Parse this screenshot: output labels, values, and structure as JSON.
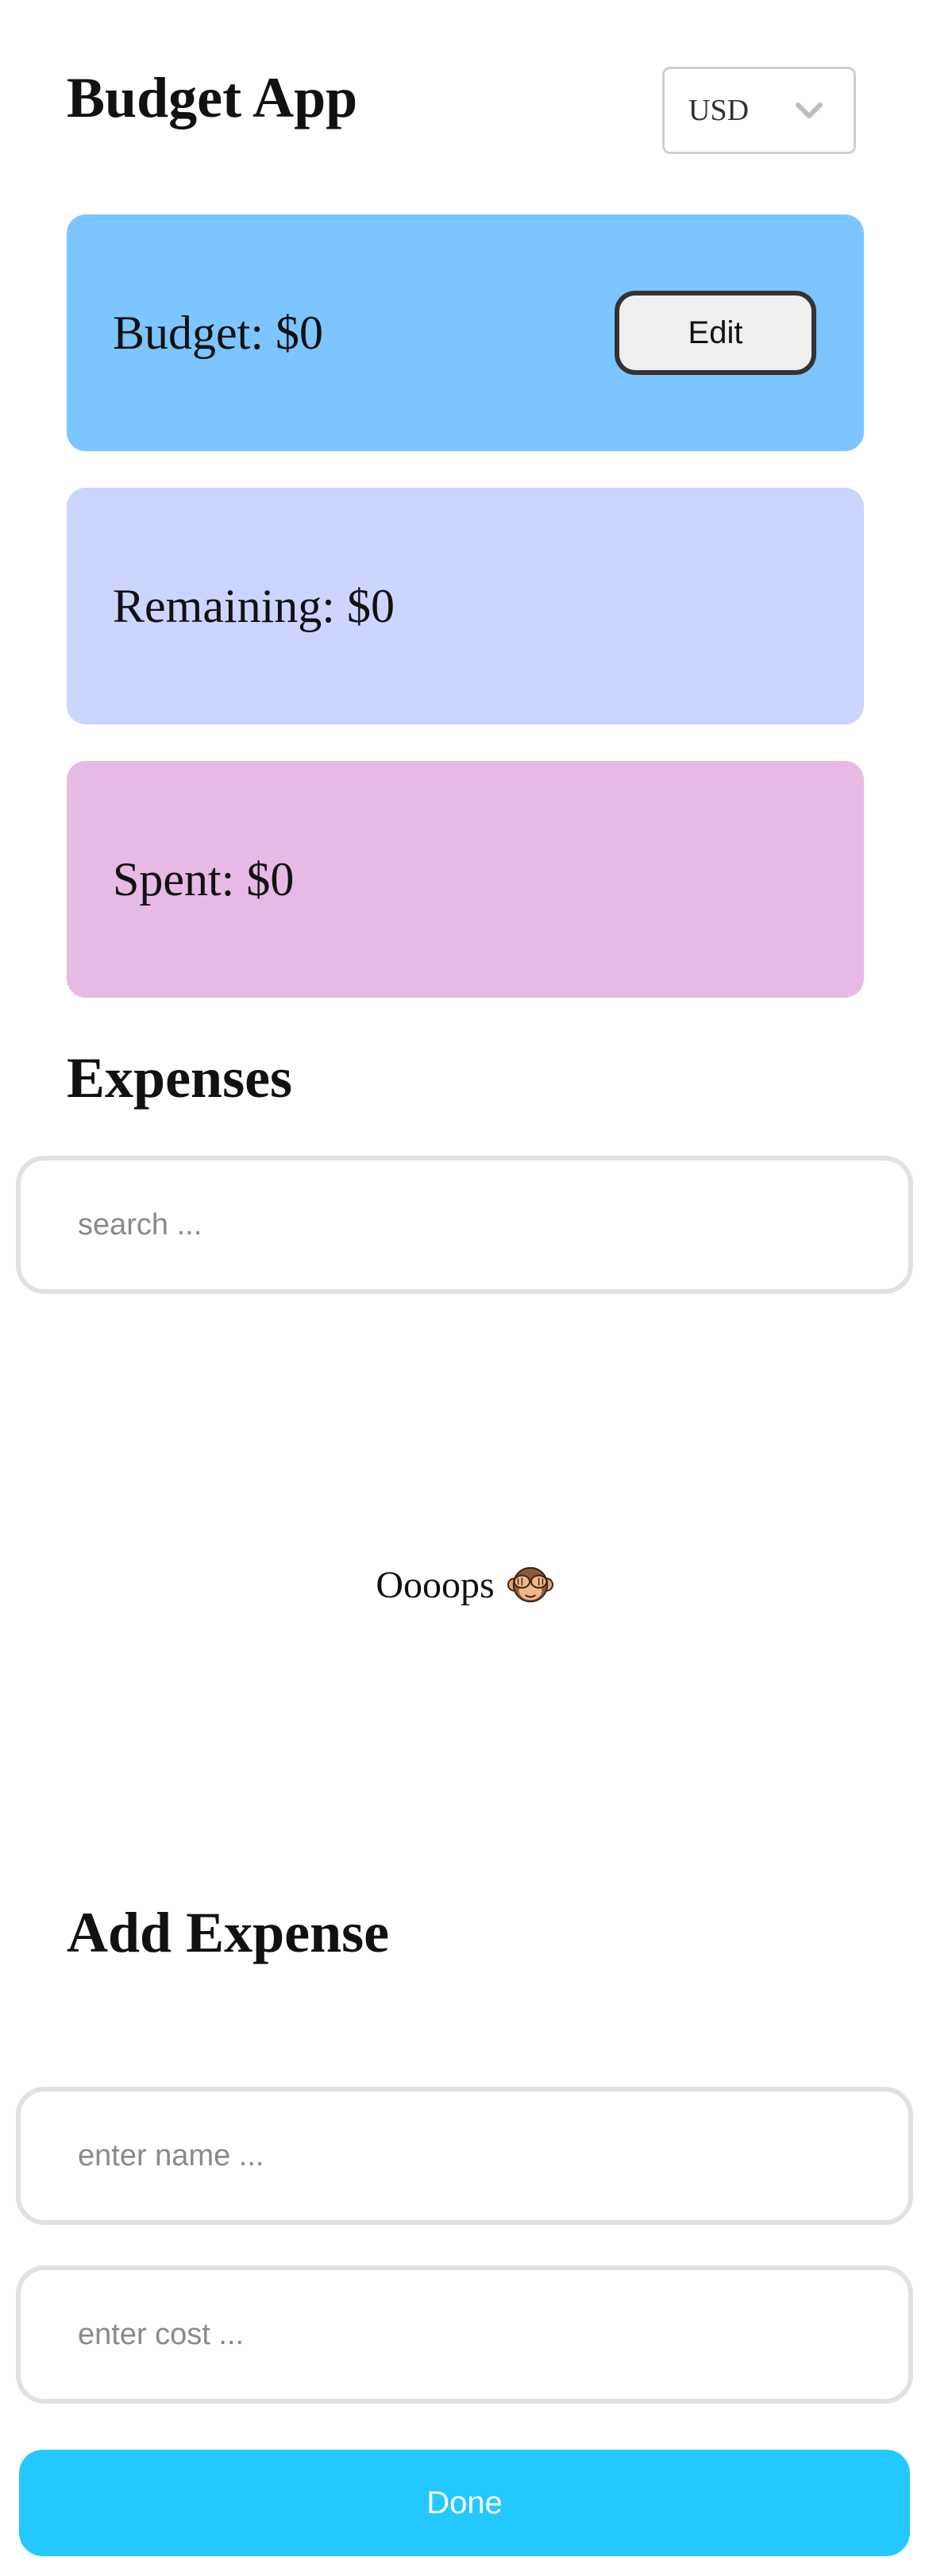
{
  "header": {
    "title": "Budget App",
    "currency": {
      "selected": "USD",
      "icon": "chevron-down-icon"
    }
  },
  "cards": {
    "budget": {
      "label": "Budget: $0",
      "edit_label": "Edit",
      "color": "#7cc5ff"
    },
    "remaining": {
      "label": "Remaining: $0",
      "color": "#ccd5ff"
    },
    "spent": {
      "label": "Spent: $0",
      "color": "#e6bae4"
    }
  },
  "expenses": {
    "title": "Expenses",
    "search_placeholder": "search ...",
    "empty_text": "Oooops",
    "empty_icon": "see-no-evil-monkey-icon"
  },
  "add_expense": {
    "title": "Add Expense",
    "name_placeholder": "enter name ...",
    "cost_placeholder": "enter cost ...",
    "done_label": "Done",
    "done_color": "#22c8ff"
  }
}
